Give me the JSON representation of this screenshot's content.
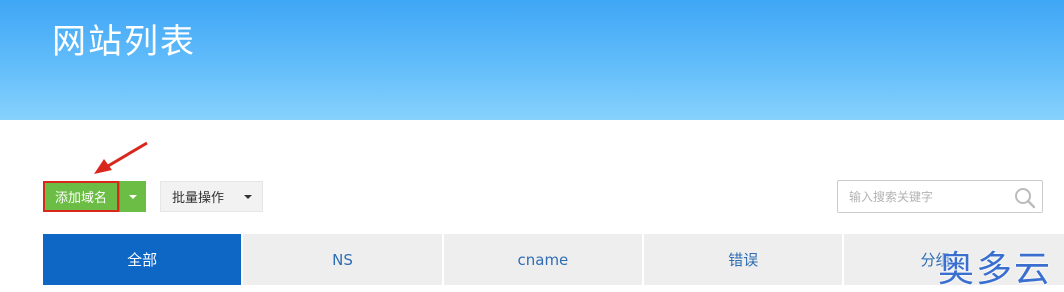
{
  "header": {
    "title": "网站列表"
  },
  "toolbar": {
    "add_domain_label": "添加域名",
    "batch_label": "批量操作"
  },
  "search": {
    "placeholder": "输入搜索关键字"
  },
  "tabs": [
    {
      "label": "全部",
      "active": true
    },
    {
      "label": "NS"
    },
    {
      "label": "cname"
    },
    {
      "label": "错误"
    },
    {
      "label": "分组"
    }
  ],
  "watermark": {
    "text": "奥多云"
  },
  "colors": {
    "header_top": "#3fa6f6",
    "header_bottom": "#86d2fd",
    "add_button": "#6cbd45",
    "highlight_border": "#d9271d",
    "active_tab": "#0e67c4",
    "tab_text": "#2d6db3",
    "annotation_arrow": "#d9271d"
  }
}
